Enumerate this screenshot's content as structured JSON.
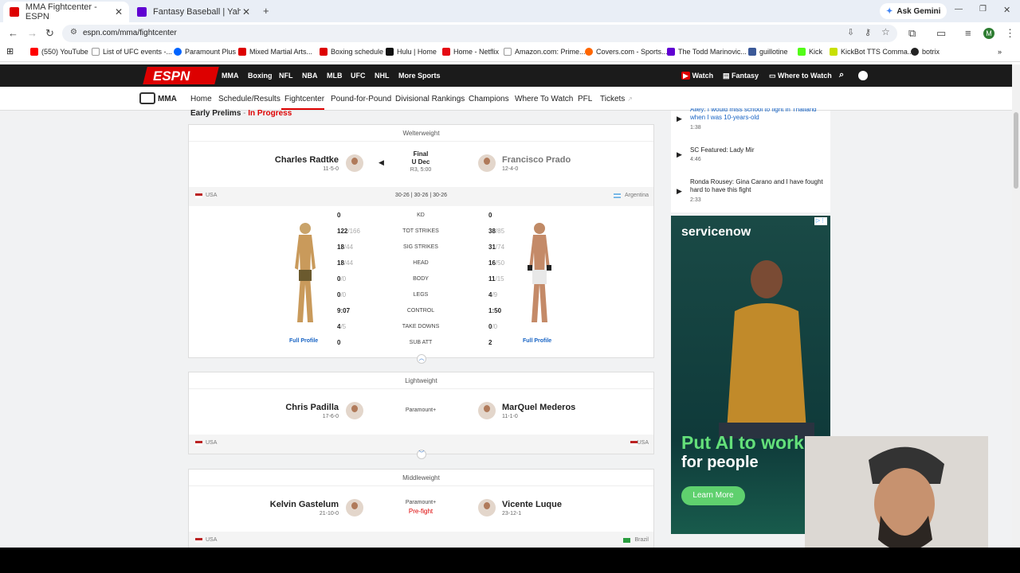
{
  "browser": {
    "tabs": [
      {
        "title": "MMA Fightcenter - ESPN"
      },
      {
        "title": "Fantasy Baseball | Yahoo! Sports"
      }
    ],
    "url": "espn.com/mma/fightcenter",
    "gemini": "Ask Gemini",
    "bookmarks": [
      "(550) YouTube",
      "List of UFC events -...",
      "Paramount Plus",
      "Mixed Martial Arts...",
      "Boxing schedule",
      "Hulu | Home",
      "Home - Netflix",
      "Amazon.com: Prime...",
      "Covers.com - Sports...",
      "The Todd Marinovic...",
      "guillotine",
      "Kick",
      "KickBot TTS Comma...",
      "botrix"
    ],
    "profile_initial": "M"
  },
  "espn": {
    "logo": "ESPN",
    "nav": [
      "MMA",
      "Boxing",
      "NFL",
      "NBA",
      "MLB",
      "UFC",
      "NHL",
      "More Sports"
    ],
    "right_nav": [
      "Watch",
      "Fantasy",
      "Where to Watch"
    ],
    "sub_logo": "MMA",
    "subnav": [
      "Home",
      "Schedule/Results",
      "Fightcenter",
      "Pound-for-Pound",
      "Divisional Rankings",
      "Champions",
      "Where To Watch",
      "PFL",
      "Tickets"
    ]
  },
  "section": {
    "title": "Early Prelims",
    "dash": " - ",
    "status": "In Progress"
  },
  "fight1": {
    "weight": "Welterweight",
    "red": {
      "name": "Charles Radtke",
      "record": "11-5-0",
      "country": "USA"
    },
    "blue": {
      "name": "Francisco Prado",
      "record": "12-4-0",
      "country": "Argentina"
    },
    "result": {
      "line1": "Final",
      "line2": "U Dec",
      "line3": "R3, 5:00"
    },
    "scores": "30-26 | 30-26 | 30-26",
    "stats": [
      {
        "label": "KD",
        "l": "0",
        "lt": "",
        "r": "0",
        "rt": ""
      },
      {
        "label": "TOT STRIKES",
        "l": "122",
        "lt": "/166",
        "r": "38",
        "rt": "/85"
      },
      {
        "label": "SIG STRIKES",
        "l": "18",
        "lt": "/44",
        "r": "31",
        "rt": "/74"
      },
      {
        "label": "HEAD",
        "l": "18",
        "lt": "/44",
        "r": "16",
        "rt": "/50"
      },
      {
        "label": "BODY",
        "l": "0",
        "lt": "/0",
        "r": "11",
        "rt": "/15"
      },
      {
        "label": "LEGS",
        "l": "0",
        "lt": "/0",
        "r": "4",
        "rt": "/9"
      },
      {
        "label": "CONTROL",
        "l": "9:07",
        "lt": "",
        "r": "1:50",
        "rt": ""
      },
      {
        "label": "TAKE DOWNS",
        "l": "4",
        "lt": "/5",
        "r": "0",
        "rt": "/0"
      },
      {
        "label": "SUB ATT",
        "l": "0",
        "lt": "",
        "r": "2",
        "rt": ""
      }
    ],
    "full_profile": "Full Profile"
  },
  "fight2": {
    "weight": "Lightweight",
    "red": {
      "name": "Chris Padilla",
      "record": "17-6-0",
      "country": "USA"
    },
    "blue": {
      "name": "MarQuel Mederos",
      "record": "11-1-0",
      "country": "USA"
    },
    "network": "Paramount+"
  },
  "fight3": {
    "weight": "Middleweight",
    "red": {
      "name": "Kelvin Gastelum",
      "record": "21-10-0",
      "country": "USA"
    },
    "blue": {
      "name": "Vicente Luque",
      "record": "23-12-1",
      "country": "Brazil"
    },
    "network": "Paramount+",
    "status": "Pre-fight"
  },
  "sidebar": {
    "videos": [
      {
        "title": "Ailey: I would miss school to fight in Thailand when I was 10-years-old",
        "time": "1:38"
      },
      {
        "title": "SC Featured: Lady Mir",
        "time": "4:46"
      },
      {
        "title": "Ronda Rousey: Gina Carano and I have fought hard to have this fight",
        "time": "2:33"
      }
    ],
    "ad": {
      "brand": "servicenow",
      "headline1": "Put AI to work",
      "headline2": "for people",
      "cta": "Learn More"
    }
  }
}
